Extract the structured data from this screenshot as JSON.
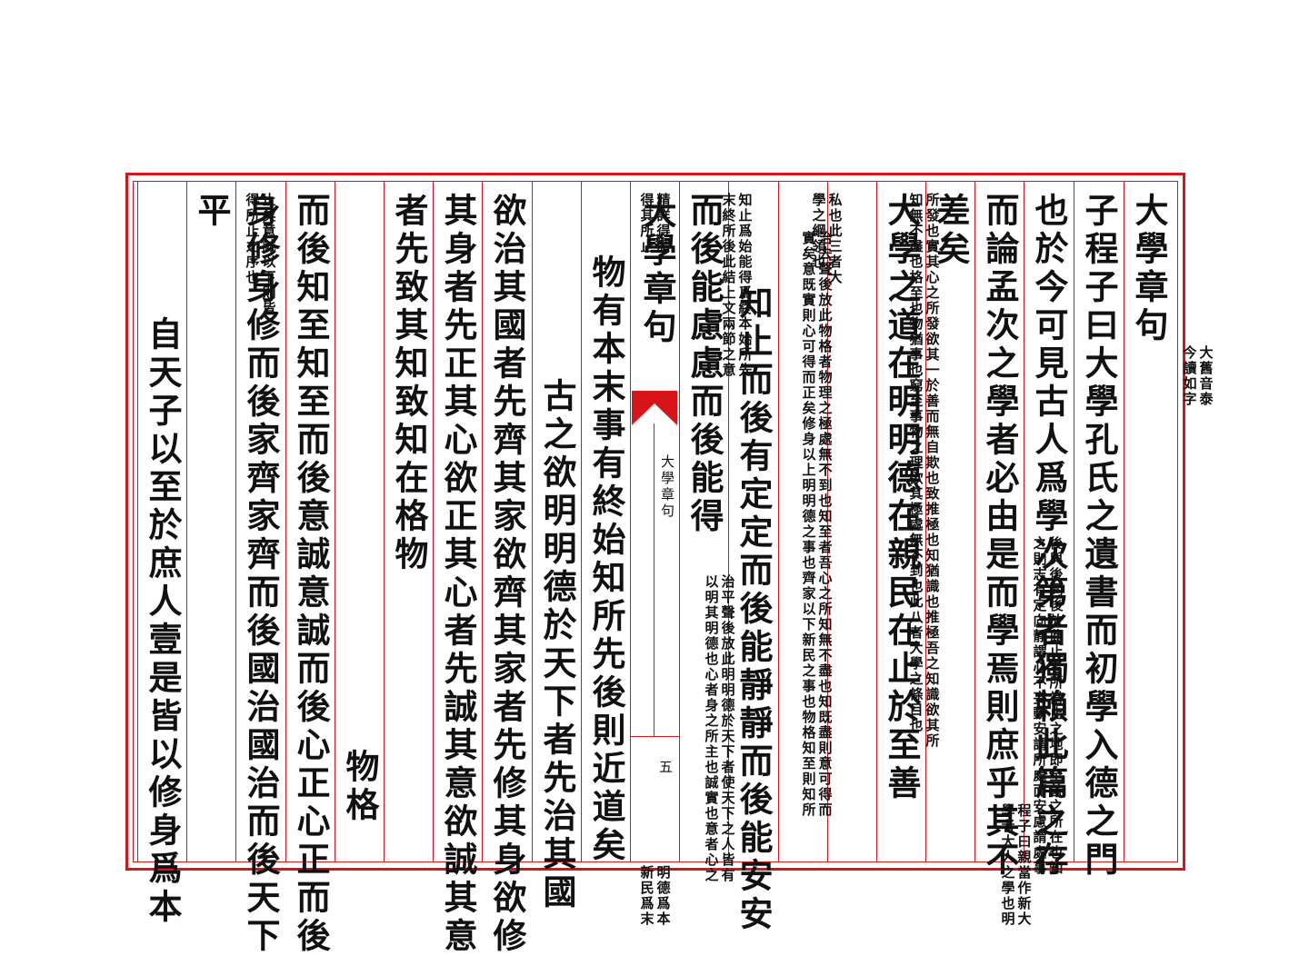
{
  "page": {
    "book_title_center": "大學章句",
    "page_number": "五",
    "columns": [
      {
        "big1": "大學章句",
        "small": [
          "大舊音泰",
          "今讀如字"
        ]
      },
      {
        "big1": "子程子曰大學孔氏之遺書而初學入德之門"
      },
      {
        "big1": "也於今可見古人爲學次第者獨賴此篇之存"
      },
      {
        "big1": "而論孟次之學者必由是而學焉則庶乎其不"
      },
      {
        "big1": "差矣"
      },
      {
        "big1": "大學之道在明明德在親民在止於至善",
        "small": [
          "程子曰親當作新大",
          "學者大人之學也明"
        ]
      },
      {
        "small": [
          "明之也明德者人之所得乎天而虛靈不昧以具衆理而應萬事者也但爲氣稟所拘人欲所蔽則有時",
          "而昏然其本體之明則有未嘗息者故學者當因其所發而遂明之以復其初也新者革其舊之謂也言"
        ]
      },
      {
        "small": [
          "既自明其明德又當推以及人使之亦有以去其舊染之汙也止者必至於是而不遷之意至善則事理",
          "當然之極也言明明德新民皆當至於至善之地而不遷蓋必其有以盡夫天理之極而無一毫人欲之"
        ]
      },
      {
        "small0": [
          "私也此三者大",
          "學之綱領也"
        ],
        "big1": "知止而後有定定而後能靜靜而後能安安"
      },
      {
        "big1": "而後能慮慮而後能得",
        "small": [
          "後與後同後放此止者所當止之地即至善之所在也知",
          "之則志有定向靜謂心不妄動安謂所處而安慮謂處事"
        ]
      },
      {
        "small0": [
          "精詳得謂",
          "得其所止"
        ],
        "big1": "物有本末事有終始知所先後則近道矣",
        "small": [
          "明德爲本",
          "新民爲末"
        ]
      },
      {
        "small0": [
          "知止爲始能得爲終本始所先",
          "末終所後此結上文兩節之意"
        ],
        "big1": "古之欲明明德於天下者先治其國"
      },
      {
        "big1": "欲治其國者先齊其家欲齊其家者先修其身欲修"
      },
      {
        "big1": "其身者先正其心欲正其心者先誠其意欲誠其意"
      },
      {
        "big1": "者先致其知致知在格物",
        "small": [
          "治平聲後放此明明德於天下者使天下之人皆有",
          "以明其明德也心者身之所主也誠實也意者心之"
        ]
      },
      {
        "small0": [
          "所發也實其心之所發欲其一於善而無自欺也致推極也知猶識也推極吾之知識欲其所",
          "知無不盡也格至也物猶事也窮至事物之理欲其極處無不到也此八者大學之條目也"
        ],
        "big1": "物格"
      },
      {
        "big1": "而後知至知至而後意誠意誠而後心正心正而後"
      },
      {
        "big1": "身修身修而後家齊家齊而後國治國治而後天下"
      },
      {
        "big1": "平",
        "small": [
          "治去聲後放此物格者物理之極處無不到也知至者吾心之所知無不盡也知既盡則意可得而",
          "實矣意既實則心可得而正矣修身以上明明德之事也齊家以下新民之事也物格知至則知所"
        ]
      },
      {
        "small0": [
          "止矣意誠以下則皆",
          "得所止之序也"
        ],
        "big1": "自天子以至於庶人壹是皆以修身爲本"
      }
    ]
  }
}
